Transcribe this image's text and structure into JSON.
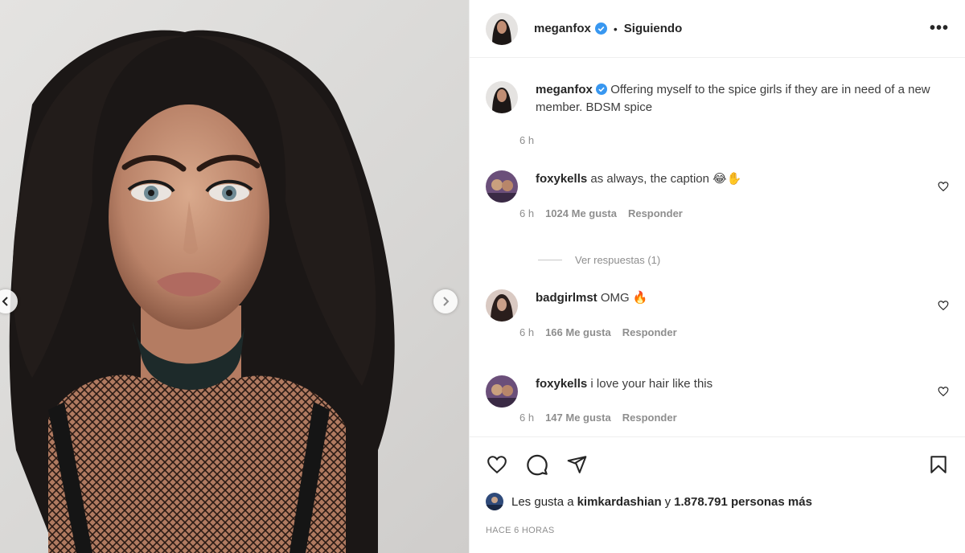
{
  "post": {
    "username": "meganfox",
    "separator": "•",
    "follow_label": "Siguiendo",
    "more_label": "•••"
  },
  "caption": {
    "username": "meganfox",
    "text": "Offering myself to the spice girls if they are in need of a new member. BDSM spice",
    "time": "6 h"
  },
  "comments": [
    {
      "username": "foxykells",
      "text": "as always, the caption 😂✋",
      "time": "6 h",
      "likes": "1024 Me gusta",
      "reply": "Responder",
      "view_replies": "Ver respuestas (1)"
    },
    {
      "username": "badgirlmst",
      "text": "OMG 🔥",
      "time": "6 h",
      "likes": "166 Me gusta",
      "reply": "Responder"
    },
    {
      "username": "foxykells",
      "text": "i love your hair like this",
      "time": "6 h",
      "likes": "147 Me gusta",
      "reply": "Responder"
    }
  ],
  "likes_line": {
    "prefix": "Les gusta a",
    "user": "kimkardashian",
    "middle": "y",
    "count": "1.878.791 personas más"
  },
  "timestamp": "HACE 6 HORAS",
  "icons": {
    "like": "heart-icon",
    "comment": "comment-icon",
    "share": "send-icon",
    "save": "bookmark-icon",
    "verified": "verified-badge-icon",
    "prev": "chevron-left-icon",
    "next": "chevron-right-icon"
  },
  "colors": {
    "verified": "#3897f0",
    "text": "#262626",
    "muted": "#8e8e8e"
  }
}
